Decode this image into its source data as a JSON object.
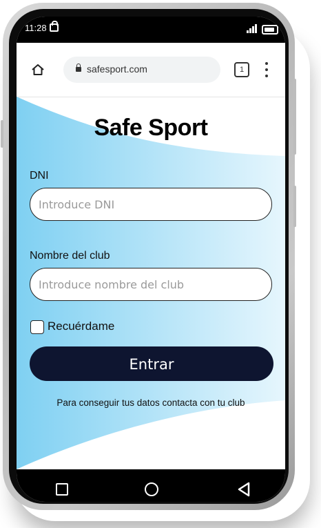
{
  "status_bar": {
    "time": "11:28"
  },
  "browser": {
    "url": "safesport.com",
    "tab_count": "1"
  },
  "page": {
    "title": "Safe Sport",
    "dni_label": "DNI",
    "dni_placeholder": "Introduce DNI",
    "club_label": "Nombre del club",
    "club_placeholder": "Introduce nombre del club",
    "remember_label": "Recuérdame",
    "submit_label": "Entrar",
    "help_text": "Para conseguir tus datos contacta con tu club"
  },
  "colors": {
    "accent_blue": "#7fd0f2",
    "button_dark": "#0e1530"
  },
  "icons": {
    "home": "home-icon",
    "lock": "lock-icon",
    "tabs": "tabs-icon",
    "menu": "more-vert-icon",
    "nav_recents": "square-icon",
    "nav_home": "circle-icon",
    "nav_back": "triangle-back-icon"
  }
}
